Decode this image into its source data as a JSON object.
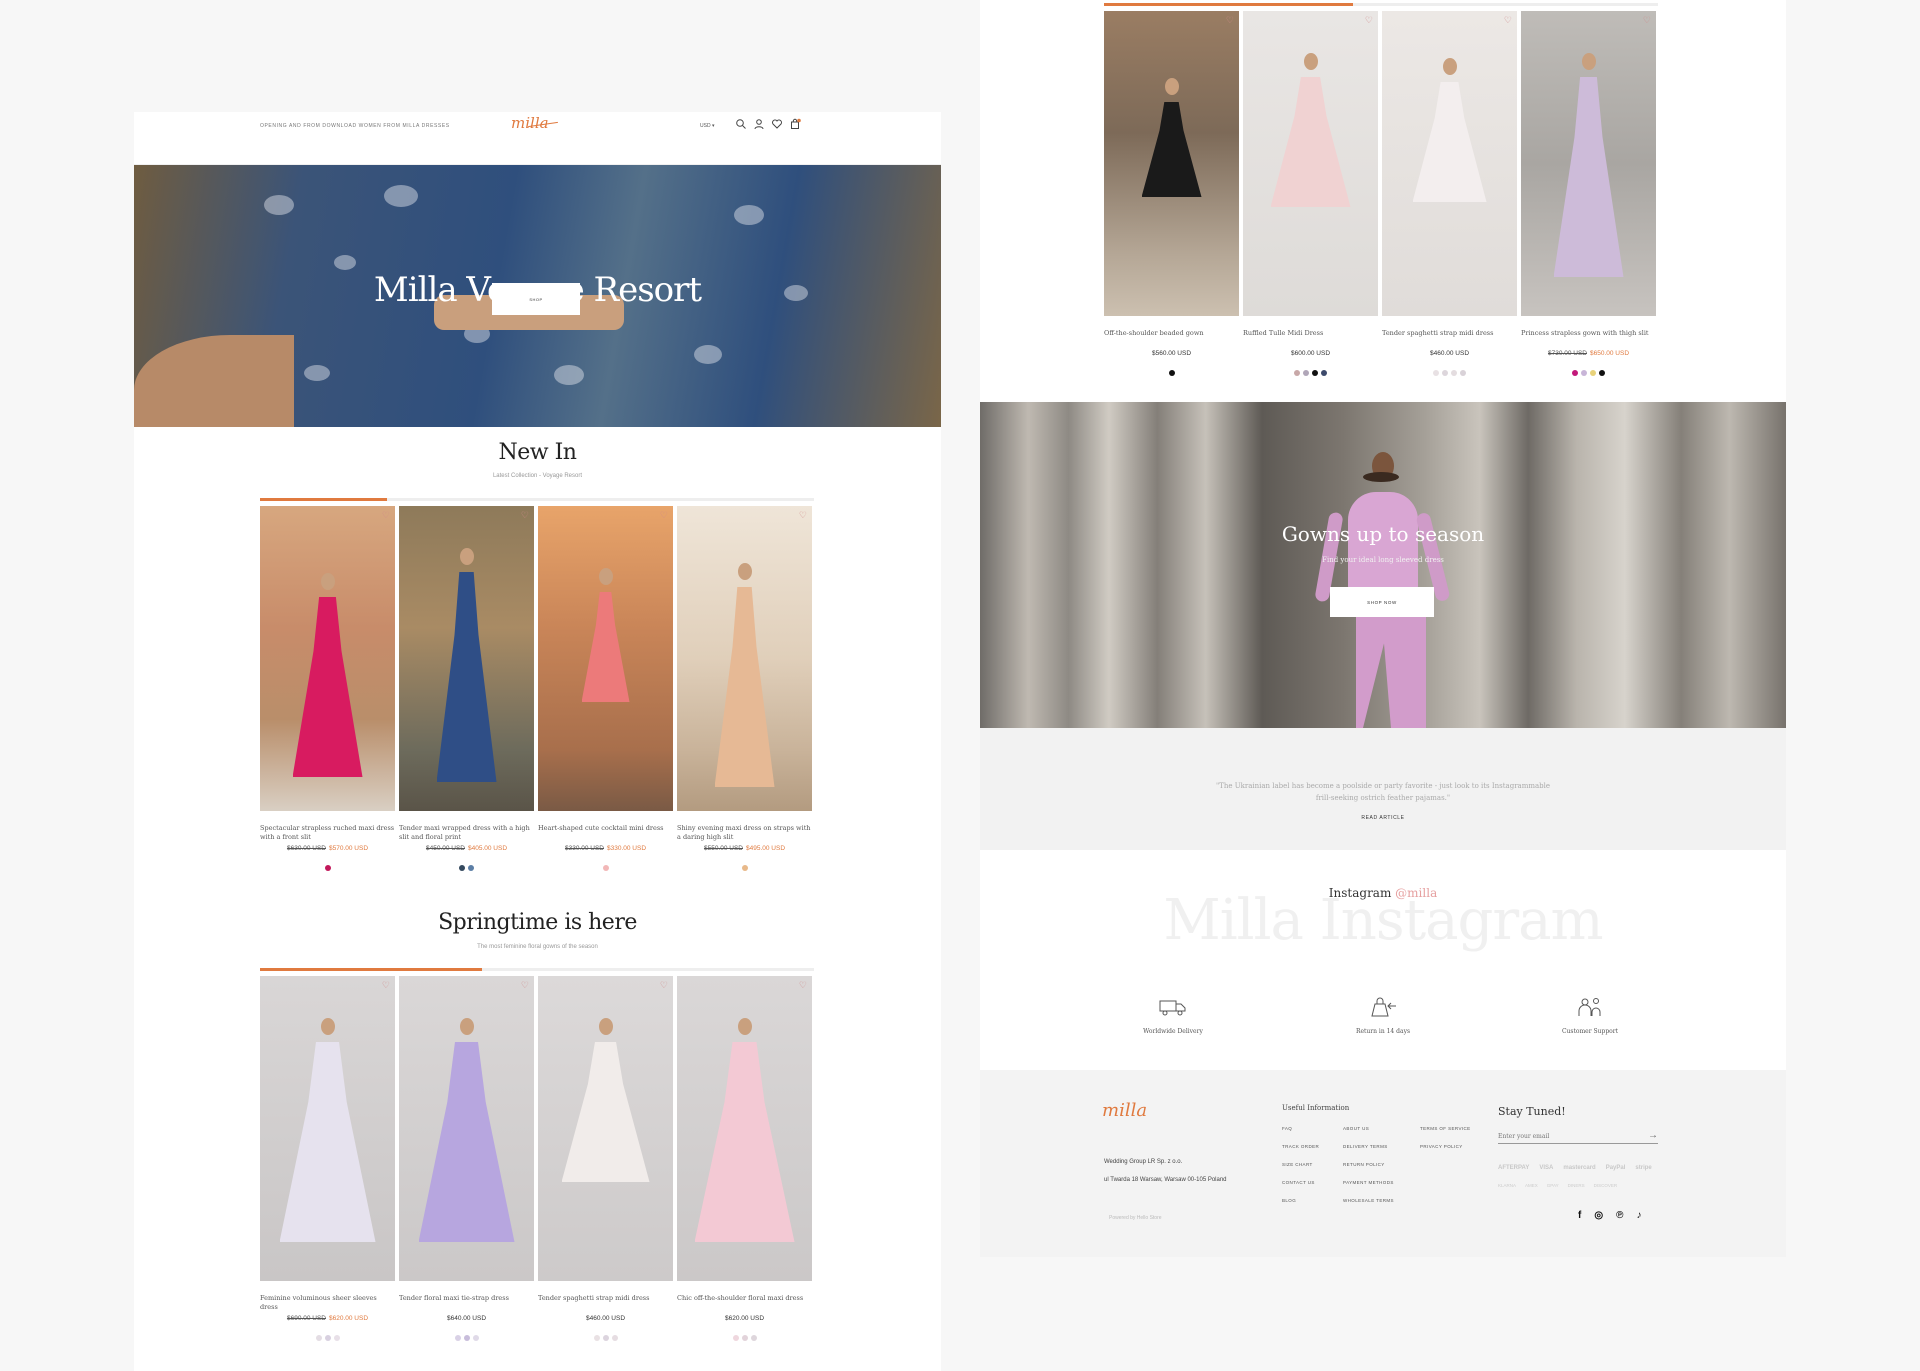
{
  "header": {
    "promo": "OPENING AND FROM DOWNLOAD WOMEN FROM MILLA DRESSES",
    "logo": "milla",
    "currency": "USD",
    "icons": [
      "search-icon",
      "user-icon",
      "heart-icon",
      "cart-icon"
    ]
  },
  "hero": {
    "title": "Milla Voyage Resort",
    "button": "SHOP"
  },
  "new_in": {
    "title": "New In",
    "subtitle": "Latest Collection - Voyage Resort",
    "progress": 0.23,
    "products": [
      {
        "name": "Spectacular strapless ruched maxi dress with a front slit",
        "old_price": "$630.00 USD",
        "price": "$570.00 USD",
        "swatches": [
          "#c2185b"
        ]
      },
      {
        "name": "Tender maxi wrapped dress with a high slit and floral print",
        "old_price": "$450.00 USD",
        "price": "$405.00 USD",
        "swatches": [
          "#34495e",
          "#5c7fa6"
        ]
      },
      {
        "name": "Heart-shaped cute cocktail mini dress",
        "old_price": "$330.00 USD",
        "price": "$330.00 USD",
        "swatches": [
          "#f2b7b7"
        ]
      },
      {
        "name": "Shiny evening maxi dress on straps with a daring high slit",
        "old_price": "$550.00 USD",
        "price": "$495.00 USD",
        "swatches": [
          "#e8b98a"
        ]
      }
    ]
  },
  "springtime": {
    "title": "Springtime is here",
    "subtitle": "The most feminine floral gowns of the season",
    "progress": 0.4,
    "products": [
      {
        "name": "Feminine voluminous sheer sleeves dress",
        "old_price": "$690.00 USD",
        "price": "$620.00 USD",
        "swatches": [
          "#e4dde4",
          "#d8d0e0",
          "#e8e0e8"
        ]
      },
      {
        "name": "Tender floral maxi tie-strap dress",
        "old_price": "",
        "price": "$640.00 USD",
        "swatches": [
          "#d9d1e6",
          "#c8bddb",
          "#e0dae8"
        ]
      },
      {
        "name": "Tender spaghetti strap midi dress",
        "old_price": "",
        "price": "$460.00 USD",
        "swatches": [
          "#e9e1e4",
          "#dcd4de",
          "#e6dde2"
        ]
      },
      {
        "name": "Chic off-the-shoulder floral maxi dress",
        "old_price": "",
        "price": "$620.00 USD",
        "swatches": [
          "#efd7de",
          "#e2d3da",
          "#ded6dc"
        ]
      }
    ]
  },
  "right_products": {
    "progress": 0.45,
    "products": [
      {
        "name": "Off-the-shoulder beaded gown",
        "old_price": "",
        "price": "$560.00 USD",
        "swatches": [
          "#111111"
        ]
      },
      {
        "name": "Ruffled Tulle Midi Dress",
        "old_price": "",
        "price": "$600.00 USD",
        "swatches": [
          "#c8a8a8",
          "#b0a6b8",
          "#111111",
          "#3d4a6b"
        ]
      },
      {
        "name": "Tender spaghetti strap midi dress",
        "old_price": "",
        "price": "$460.00 USD",
        "swatches": [
          "#e8e1e4",
          "#ddd6dc",
          "#e4dde0",
          "#d9d2d8"
        ]
      },
      {
        "name": "Princess strapless gown with thigh slit",
        "old_price": "$730.00 USD",
        "price": "$650.00 USD",
        "swatches": [
          "#c2187a",
          "#c8b5d8",
          "#e8d27a",
          "#111111"
        ]
      }
    ]
  },
  "banner": {
    "title": "Gowns up to season",
    "subtitle": "Find your ideal long sleeved dress",
    "button": "SHOP NOW"
  },
  "quote": {
    "text": "\"The Ukrainian label has become a poolside or party favorite - just look to its Instagrammable frill-seeking ostrich feather pajamas.\"",
    "link": "READ ARTICLE"
  },
  "instagram": {
    "title": "Instagram",
    "handle": "@milla",
    "watermark": "Milla Instagram"
  },
  "features": [
    {
      "icon": "delivery-truck-icon",
      "label": "Worldwide Delivery"
    },
    {
      "icon": "return-bag-icon",
      "label": "Return in 14 days"
    },
    {
      "icon": "customer-support-icon",
      "label": "Customer Support"
    }
  ],
  "footer": {
    "logo": "milla",
    "company": "Wedding Group LR Sp. z o.o.",
    "address": "ul Twarda 18 Warsaw, Warsaw 00-105 Poland",
    "powered": "Powered by Hello Store",
    "useful_title": "Useful Information",
    "links": [
      "FAQ",
      "ABOUT US",
      "TERMS OF SERVICE",
      "TRACK ORDER",
      "DELIVERY TERMS",
      "PRIVACY POLICY",
      "SIZE CHART",
      "RETURN POLICY",
      "",
      "CONTACT US",
      "PAYMENT METHODS",
      "",
      "BLOG",
      "WHOLESALE TERMS",
      ""
    ],
    "stay_tuned": "Stay Tuned!",
    "email_placeholder": "Enter your email",
    "payments": [
      "AFTERPAY",
      "VISA",
      "mastercard",
      "PayPal",
      "stripe"
    ],
    "payments2": [
      "KLARNA",
      "AMEX",
      "GPAY",
      "DINERS",
      "DISCOVER"
    ],
    "social": [
      "facebook-icon",
      "instagram-icon",
      "pinterest-icon",
      "tiktok-icon"
    ]
  }
}
